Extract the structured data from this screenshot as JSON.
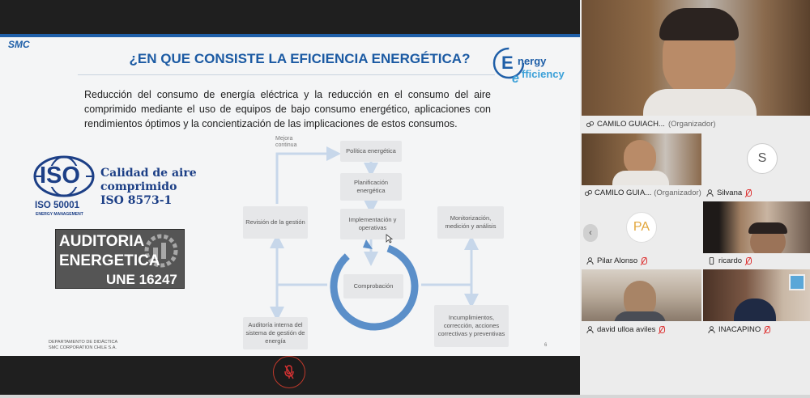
{
  "slide": {
    "logo": "SMC",
    "title": "¿EN QUE CONSISTE LA EFICIENCIA ENERGÉTICA?",
    "ee_logo_line1": "nergy",
    "ee_logo_line2": "fficiency",
    "body": "Reducción del consumo de energía eléctrica y la reducción en el consumo del aire comprimido mediante el uso de equipos de bajo consumo energético, aplicaciones con rendimientos óptimos y la concientización de las implicaciones de estos consumos.",
    "iso": {
      "text": "ISO",
      "number": "ISO 50001",
      "sub": "ENERGY MANAGEMENT"
    },
    "calidad": [
      "Calidad de aire",
      "comprimido",
      "ISO 8573-1"
    ],
    "auditoria": [
      "AUDITORIA",
      "ENERGETICA",
      "UNE 16247"
    ],
    "footer_dept": [
      "DEPARTAMENTO DE DIDÁCTICA",
      "SMC CORPORATION CHILE S.A."
    ],
    "page_number": "6",
    "diagram": {
      "mejora": [
        "Mejora",
        "continua"
      ],
      "politica": "Política energética",
      "planificacion": "Planificación energética",
      "implementacion": "Implementación y operativas",
      "revision": "Revisión de la gestión",
      "monitorizacion": "Monitorización, medición y análisis",
      "comprobacion": "Comprobación",
      "auditoria_interna": "Auditoría interna del sistema de gestión de energía",
      "incumplimientos": "Incumplimientos, corrección, acciones correctivas y preventivas"
    }
  },
  "participants": [
    {
      "name": "CAMILO GUIACH...",
      "role": "(Organizador)"
    },
    {
      "name": "CAMILO GUIA...",
      "role": "(Organizador)"
    },
    {
      "name": "Silvana",
      "initial": "S"
    },
    {
      "name": "Pilar Alonso",
      "initial": "PA"
    },
    {
      "name": "ricardo"
    },
    {
      "name": "david ulloa aviles"
    },
    {
      "name": "INACAPINO"
    }
  ],
  "colors": {
    "slide_blue": "#1b5aa3",
    "cycle_blue": "#5b8fc9",
    "mute_red": "#d33"
  }
}
